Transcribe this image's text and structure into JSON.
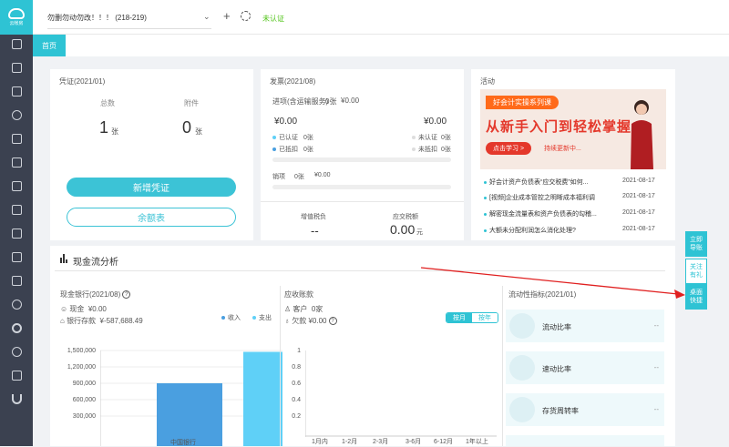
{
  "app": {
    "logo_text": "云帐房",
    "company": "勿删勿动勿改！！！ (218-219)",
    "cert_status": "未认证"
  },
  "tabs": [
    {
      "label": "首页"
    }
  ],
  "voucher": {
    "title": "凭证(2021/01)",
    "total_label": "总数",
    "total_value": "1",
    "total_unit": "张",
    "attach_label": "附件",
    "attach_value": "0",
    "attach_unit": "张",
    "new_btn": "新增凭证",
    "balance_btn": "余额表"
  },
  "invoice": {
    "title": "发票(2021/08)",
    "input_label": "进项(含运输服务)",
    "input_count": "0张",
    "input_amount": "¥0.00",
    "amt_left": "¥0.00",
    "amt_right": "¥0.00",
    "certified": "已认证",
    "certified_n": "0张",
    "uncertified": "未认证",
    "uncertified_n": "0张",
    "deducted": "已抵扣",
    "deducted_n": "0张",
    "undeducted": "未抵扣",
    "undeducted_n": "0张",
    "output_label": "销项",
    "output_count": "0张",
    "output_amount": "¥0.00",
    "vat_label": "增值税负",
    "vat_value": "--",
    "tax_label": "应交税额",
    "tax_value": "0.00",
    "tax_unit": "元"
  },
  "activity": {
    "title": "活动",
    "banner_tag": "好会计实操系列课",
    "banner_title": "从新手入门到轻松掌握",
    "banner_btn": "点击学习 >",
    "banner_sub": "持续更新中...",
    "news": [
      {
        "text": "好会计资产负债表“应交税费”如何...",
        "date": "2021-08-17"
      },
      {
        "text": "[视频]企业成本管控之明晰成本福利调",
        "date": "2021-08-17"
      },
      {
        "text": "解密现金流量表和资产负债表的勾稽...",
        "date": "2021-08-17"
      },
      {
        "text": "大额未分配利润怎么消化处理?",
        "date": "2021-08-17"
      }
    ]
  },
  "cashflow": {
    "title": "现金流分析",
    "bank_title": "现金银行(2021/08)",
    "cash_label": "现金",
    "cash_value": "¥0.00",
    "bank_label": "银行存款",
    "bank_value": "¥-587,688.49",
    "legend_in": "收入",
    "legend_out": "支出",
    "recv_title": "应收账款",
    "customer_label": "客户",
    "customer_value": "0家",
    "owed_label": "欠款",
    "owed_value": "¥0.00",
    "seg_month": "按月",
    "seg_year": "按年",
    "liq_title": "流动性指标(2021/01)",
    "liq": [
      {
        "name": "流动比率",
        "value": "--"
      },
      {
        "name": "速动比率",
        "value": "--"
      },
      {
        "name": "存货周转率",
        "value": "--"
      }
    ]
  },
  "float": [
    "立即导账",
    "关注有礼",
    "桌面快捷"
  ],
  "colors": {
    "accent": "#2ec3d4",
    "income": "#4a9fe0",
    "expense": "#5fd0f7"
  },
  "chart_data": [
    {
      "type": "bar",
      "categories": [
        "中国银行"
      ],
      "series": [
        {
          "name": "收入",
          "values": [
            900000
          ]
        },
        {
          "name": "支出",
          "values": [
            1475000
          ]
        }
      ],
      "yticks": [
        "1,500,000",
        "1,200,000",
        "900,000",
        "600,000",
        "300,000",
        "0"
      ],
      "ylim": [
        0,
        1500000
      ]
    },
    {
      "type": "bar",
      "categories": [
        "1月内",
        "1-2月",
        "2-3月",
        "3-6月",
        "6-12月",
        "1年以上"
      ],
      "values": [
        0,
        0,
        0,
        0,
        0,
        0
      ],
      "yticks": [
        "1",
        "0.8",
        "0.6",
        "0.4",
        "0.2",
        "0"
      ],
      "ylim": [
        0,
        1
      ]
    }
  ]
}
